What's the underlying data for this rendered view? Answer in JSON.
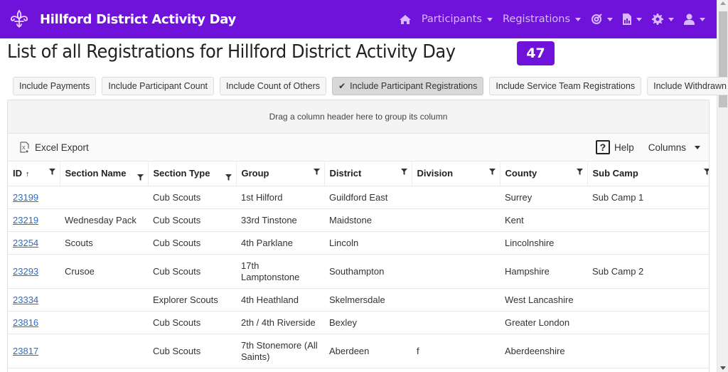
{
  "navbar": {
    "title": "Hillford District Activity Day",
    "items": [
      {
        "label": "Participants"
      },
      {
        "label": "Registrations"
      }
    ],
    "icons": [
      "home-icon",
      "target-icon",
      "report-icon",
      "settings-icon",
      "user-icon"
    ]
  },
  "page": {
    "title": "List of all Registrations for Hillford District Activity Day",
    "count": "47"
  },
  "toggles": [
    {
      "label": "Include Payments",
      "active": false
    },
    {
      "label": "Include Participant Count",
      "active": false
    },
    {
      "label": "Include Count of Others",
      "active": false
    },
    {
      "label": "Include Participant Registrations",
      "active": true
    },
    {
      "label": "Include Service Team Registrations",
      "active": false
    },
    {
      "label": "Include Withdrawn",
      "active": false
    }
  ],
  "grid": {
    "group_hint": "Drag a column header here to group its column",
    "excel_export": "Excel Export",
    "help": "Help",
    "columns_menu": "Columns",
    "columns": [
      {
        "label": "ID",
        "sort": "↑"
      },
      {
        "label": "Section Name"
      },
      {
        "label": "Section Type"
      },
      {
        "label": "Group"
      },
      {
        "label": "District"
      },
      {
        "label": "Division"
      },
      {
        "label": "County"
      },
      {
        "label": "Sub Camp"
      }
    ],
    "rows": [
      {
        "id": "23199",
        "section_name": "",
        "section_type": "Cub Scouts",
        "group": "1st Hilford",
        "district": "Guildford East",
        "division": "",
        "county": "Surrey",
        "sub_camp": "Sub Camp 1"
      },
      {
        "id": "23219",
        "section_name": "Wednesday Pack",
        "section_type": "Cub Scouts",
        "group": "33rd Tinstone",
        "district": "Maidstone",
        "division": "",
        "county": "Kent",
        "sub_camp": ""
      },
      {
        "id": "23254",
        "section_name": "Scouts",
        "section_type": "Cub Scouts",
        "group": "4th Parklane",
        "district": "Lincoln",
        "division": "",
        "county": "Lincolnshire",
        "sub_camp": ""
      },
      {
        "id": "23293",
        "section_name": "Crusoe",
        "section_type": "Cub Scouts",
        "group": "17th Lamptonstone",
        "district": "Southampton",
        "division": "",
        "county": "Hampshire",
        "sub_camp": "Sub Camp 2"
      },
      {
        "id": "23334",
        "section_name": "",
        "section_type": "Explorer Scouts",
        "group": "4th Heathland",
        "district": "Skelmersdale",
        "division": "",
        "county": "West Lancashire",
        "sub_camp": ""
      },
      {
        "id": "23816",
        "section_name": "",
        "section_type": "Cub Scouts",
        "group": "2th / 4th Riverside",
        "district": "Bexley",
        "division": "",
        "county": "Greater London",
        "sub_camp": ""
      },
      {
        "id": "23817",
        "section_name": "",
        "section_type": "Cub Scouts",
        "group": "7th Stonemore (All Saints)",
        "district": "Aberdeen",
        "division": "f",
        "county": "Aberdeenshire",
        "sub_camp": ""
      }
    ]
  },
  "colors": {
    "brand": "#6f13db",
    "nav_text": "#d9b8ff",
    "link": "#2b6cc4"
  }
}
